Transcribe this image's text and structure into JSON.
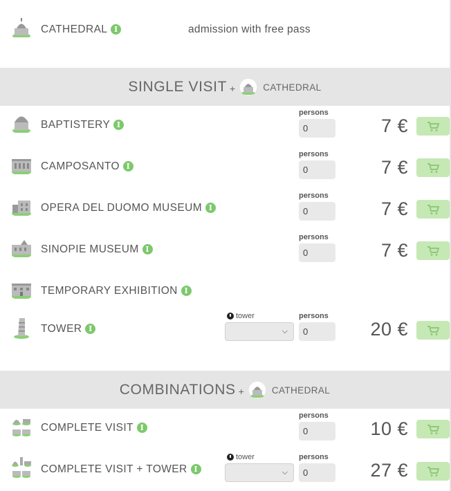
{
  "cathedral": {
    "name": "CATHEDRAL",
    "note": "admission with free pass",
    "info": "i"
  },
  "single_section": {
    "title": "SINGLE VISIT",
    "plus": "+",
    "sub": "CATHEDRAL"
  },
  "combo_section": {
    "title": "COMBINATIONS",
    "plus": "+",
    "sub": "CATHEDRAL"
  },
  "labels": {
    "persons": "persons",
    "tower": "tower",
    "info": "i"
  },
  "single_items": [
    {
      "name": "BAPTISTERY",
      "persons": "0",
      "price": "7 €"
    },
    {
      "name": "CAMPOSANTO",
      "persons": "0",
      "price": "7 €"
    },
    {
      "name": "OPERA DEL DUOMO MUSEUM",
      "persons": "0",
      "price": "7 €"
    },
    {
      "name": "SINOPIE MUSEUM",
      "persons": "0",
      "price": "7 €"
    },
    {
      "name": "TEMPORARY EXHIBITION"
    },
    {
      "name": "TOWER",
      "persons": "0",
      "price": "20 €",
      "tower_select": ""
    }
  ],
  "combo_items": [
    {
      "name": "COMPLETE VISIT",
      "persons": "0",
      "price": "10 €"
    },
    {
      "name": "COMPLETE VISIT + TOWER",
      "persons": "0",
      "price": "27 €",
      "tower_select": ""
    }
  ],
  "colors": {
    "accent_green": "#7cc96b",
    "cart_bg": "#c6e8b5",
    "band": "#e5e5e5"
  },
  "icons": {
    "cathedral": "cathedral-icon",
    "baptistery": "baptistery-icon",
    "camposanto": "camposanto-icon",
    "museum": "museum-icon",
    "sinopie": "sinopie-icon",
    "exhibition": "exhibition-icon",
    "tower": "tower-icon",
    "cart": "cart-icon",
    "clock": "clock-icon",
    "chevron": "chevron-down-icon",
    "info": "info-icon"
  }
}
